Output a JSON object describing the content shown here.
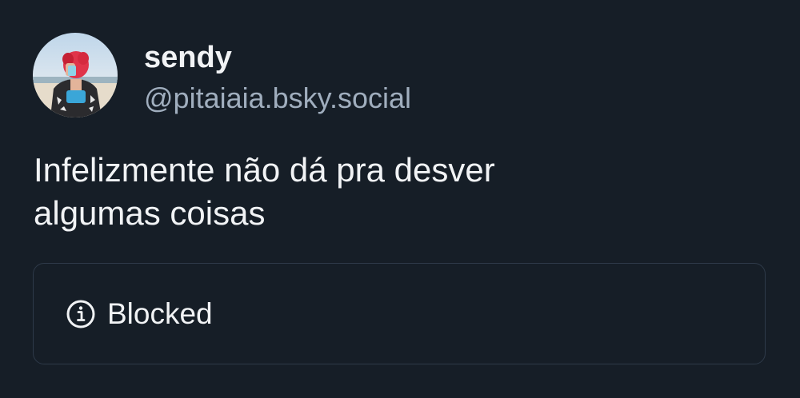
{
  "post": {
    "author": {
      "display_name": "sendy",
      "handle": "@pitaiaia.bsky.social",
      "avatar_icon": "profile-photo"
    },
    "text_lines": [
      "Infelizmente não dá pra desver",
      "algumas coisas"
    ],
    "embed": {
      "icon": "info-icon",
      "label": "Blocked"
    }
  },
  "colors": {
    "background": "#161e27",
    "text": "#f1f3f5",
    "muted": "#a0aebe",
    "border": "#2e3a49"
  }
}
